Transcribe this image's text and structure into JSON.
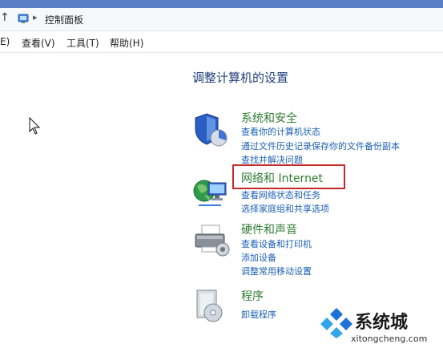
{
  "window": {
    "address_chevron": "▸",
    "breadcrumb": "控制面板"
  },
  "menubar": {
    "items": [
      "E)",
      "查看(V)",
      "工具(T)",
      "帮助(H)"
    ]
  },
  "main": {
    "title": "调整计算机的设置",
    "categories": [
      {
        "heading": "系统和安全",
        "icon": "shield-icon",
        "links": [
          "查看你的计算机状态",
          "通过文件历史记录保存你的文件备份副本",
          "查找并解决问题"
        ]
      },
      {
        "heading": "网络和 Internet",
        "icon": "network-globe-icon",
        "links": [
          "查看网络状态和任务",
          "选择家庭组和共享选项"
        ]
      },
      {
        "heading": "硬件和声音",
        "icon": "printer-icon",
        "links": [
          "查看设备和打印机",
          "添加设备",
          "调整常用移动设置"
        ]
      },
      {
        "heading": "程序",
        "icon": "programs-box-icon",
        "links": [
          "卸载程序"
        ]
      }
    ]
  },
  "watermark": {
    "name": "系统城",
    "url": "xitongcheng.com"
  },
  "colors": {
    "link": "#1a5fb4",
    "heading": "#2e7d32",
    "title": "#1f3f7a",
    "highlight": "#c62828"
  }
}
